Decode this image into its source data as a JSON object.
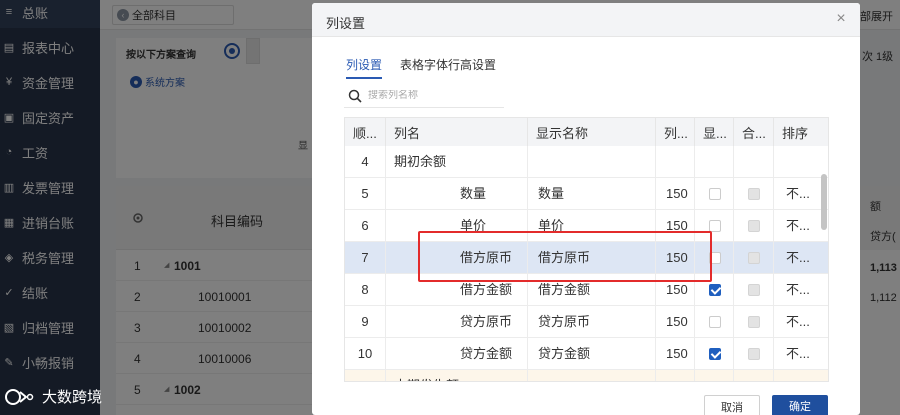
{
  "sidebar": {
    "items": [
      {
        "label": "总账",
        "icon": "ledger-icon",
        "glyph": "≡"
      },
      {
        "label": "报表中心",
        "icon": "report-icon",
        "glyph": "▤"
      },
      {
        "label": "资金管理",
        "icon": "fund-icon",
        "glyph": "¥"
      },
      {
        "label": "固定资产",
        "icon": "asset-icon",
        "glyph": "▣"
      },
      {
        "label": "工资",
        "icon": "salary-icon",
        "glyph": "◔"
      },
      {
        "label": "发票管理",
        "icon": "invoice-icon",
        "glyph": "▥"
      },
      {
        "label": "进销台账",
        "icon": "inventory-icon",
        "glyph": "▦"
      },
      {
        "label": "税务管理",
        "icon": "tax-icon",
        "glyph": "◈"
      },
      {
        "label": "结账",
        "icon": "close-account-icon",
        "glyph": "✓"
      },
      {
        "label": "归档管理",
        "icon": "archive-icon",
        "glyph": "▧"
      },
      {
        "label": "小畅报销",
        "icon": "reimburse-icon",
        "glyph": "✎"
      }
    ]
  },
  "background": {
    "subject_select": "全部科目",
    "expand_link": "部展开",
    "query_title": "按以下方案查询",
    "scheme_link": "系统方案",
    "side_char": "显",
    "right_text": "次  1级",
    "grid_code_header": "科目编码",
    "grid_rows": [
      {
        "rn": "1",
        "code": "1001",
        "bold": true
      },
      {
        "rn": "2",
        "code": "10010001",
        "bold": false
      },
      {
        "rn": "3",
        "code": "10010002",
        "bold": false
      },
      {
        "rn": "4",
        "code": "10010006",
        "bold": false
      },
      {
        "rn": "5",
        "code": "1002",
        "bold": true
      }
    ],
    "right_grid": {
      "h1": "额",
      "h2": "贷方(",
      "v1": "1,113",
      "v2": "1,112"
    }
  },
  "modal": {
    "title": "列设置",
    "tabs": [
      {
        "label": "列设置",
        "active": true
      },
      {
        "label": "表格字体行高设置",
        "active": false
      }
    ],
    "search_placeholder": "搜索列名称",
    "columns": {
      "seq": "顺...",
      "name": "列名",
      "display": "显示名称",
      "width": "列...",
      "show": "显...",
      "merge": "合...",
      "sort": "排序"
    },
    "rows": [
      {
        "seq": "4",
        "name": "期初余额",
        "display": "",
        "width": "",
        "show": null,
        "merge": null,
        "sort": "",
        "indent": false,
        "state": "normal"
      },
      {
        "seq": "5",
        "name": "数量",
        "display": "数量",
        "width": "150",
        "show": false,
        "merge": false,
        "sort": "不...",
        "indent": true,
        "state": "normal"
      },
      {
        "seq": "6",
        "name": "单价",
        "display": "单价",
        "width": "150",
        "show": false,
        "merge": false,
        "sort": "不...",
        "indent": true,
        "state": "normal"
      },
      {
        "seq": "7",
        "name": "借方原币",
        "display": "借方原币",
        "width": "150",
        "show": false,
        "merge": false,
        "sort": "不...",
        "indent": true,
        "state": "selected"
      },
      {
        "seq": "8",
        "name": "借方金额",
        "display": "借方金额",
        "width": "150",
        "show": true,
        "merge": false,
        "sort": "不...",
        "indent": true,
        "state": "normal"
      },
      {
        "seq": "9",
        "name": "贷方原币",
        "display": "贷方原币",
        "width": "150",
        "show": false,
        "merge": false,
        "sort": "不...",
        "indent": true,
        "state": "normal"
      },
      {
        "seq": "10",
        "name": "贷方金额",
        "display": "贷方金额",
        "width": "150",
        "show": true,
        "merge": false,
        "sort": "不...",
        "indent": true,
        "state": "normal"
      },
      {
        "seq": "11",
        "name": "本期发生额",
        "display": "",
        "width": "",
        "show": null,
        "merge": null,
        "sort": "",
        "indent": false,
        "state": "partial"
      }
    ],
    "buttons": {
      "cancel": "取消",
      "ok": "确定"
    }
  },
  "watermark": {
    "text": "大数跨境"
  },
  "colors": {
    "accent": "#1f4f9e",
    "sidebar": "#28344a",
    "highlight": "#e32b2b",
    "selected_row": "#dde6f4"
  }
}
